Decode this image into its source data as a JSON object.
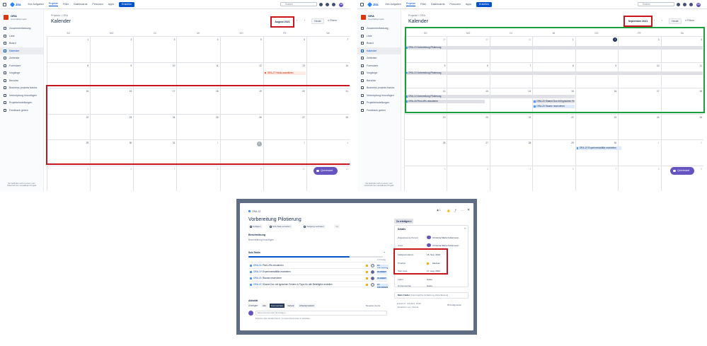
{
  "colors": {
    "brand": "#0052cc",
    "highlight_red": "#c9151e",
    "highlight_green": "#1b9e3e",
    "fab": "#6554c0",
    "project_icon": "#de350b"
  },
  "topbar": {
    "product": "Jira",
    "nav": [
      "Ihre Aufgaben",
      "Projekte",
      "Filter",
      "Dashboards",
      "Personen",
      "Apps"
    ],
    "create_label": "Erstellen",
    "search_placeholder": "Suchen",
    "avatar_initials": "CM",
    "icons": [
      "bell-icon",
      "help-icon",
      "settings-icon"
    ]
  },
  "sidebar": {
    "project_name": "ORA",
    "project_type": "Geschäftsprojekt",
    "items": [
      {
        "label": "Zusammenfassung",
        "icon": "summary-icon",
        "active": false
      },
      {
        "label": "Liste",
        "icon": "list-icon",
        "active": false
      },
      {
        "label": "Board",
        "icon": "board-icon",
        "active": false
      },
      {
        "label": "Kalender",
        "icon": "calendar-icon",
        "active": true
      },
      {
        "label": "Zeitleiste",
        "icon": "timeline-icon",
        "active": false
      },
      {
        "label": "Formulare",
        "icon": "forms-icon",
        "active": false
      },
      {
        "label": "Vorgänge",
        "icon": "issues-icon",
        "active": false
      },
      {
        "label": "Berichte",
        "icon": "reports-icon",
        "active": false
      },
      {
        "label": "Business projects basics",
        "icon": "book-icon",
        "active": false
      },
      {
        "label": "Verknüpfung hinzufügen",
        "icon": "link-icon",
        "active": false
      },
      {
        "label": "Projekteinstellungen",
        "icon": "gear-icon",
        "active": false
      },
      {
        "label": "Feedback geben",
        "icon": "megaphone-icon",
        "active": false
      }
    ],
    "footer": "Sie befinden sich in einem vom Unternehmen verwalteten Projekt"
  },
  "calendar_common": {
    "breadcrumb_root": "Projekte",
    "breadcrumb_project": "ORA",
    "title": "Kalender",
    "prev": "‹",
    "next": "›",
    "today_label": "Heute",
    "filter_label": "Filtern",
    "weekdays": [
      "SO",
      "MO",
      "DI",
      "MI",
      "DO",
      "FR",
      "SA"
    ],
    "fab_label": "Quickstart"
  },
  "left_calendar": {
    "month_label": "August 2021",
    "weeks": [
      [
        "1",
        "2",
        "3",
        "4",
        "5",
        "6",
        "7"
      ],
      [
        "8",
        "9",
        "10",
        "11",
        "12",
        "13",
        "14"
      ],
      [
        "15",
        "16",
        "17",
        "18",
        "19",
        "20",
        "21"
      ],
      [
        "22",
        "23",
        "24",
        "25",
        "26",
        "27",
        "28"
      ],
      [
        "29",
        "30",
        "31",
        "1",
        "2",
        "3",
        "4"
      ],
      [
        "5",
        "6",
        "7",
        "8",
        "9",
        "10",
        "11"
      ]
    ],
    "event": "ORA-27 Hosts auswählen"
  },
  "right_calendar": {
    "month_label": "September 2021",
    "weeks": [
      [
        "29",
        "30",
        "31",
        "1",
        "2",
        "3",
        "4"
      ],
      [
        "5",
        "6",
        "7",
        "8",
        "9",
        "10",
        "11"
      ],
      [
        "12",
        "13",
        "14",
        "15",
        "16",
        "17",
        "18"
      ],
      [
        "19",
        "20",
        "21",
        "22",
        "23",
        "24",
        "25"
      ],
      [
        "26",
        "27",
        "28",
        "29",
        "30",
        "1",
        "2"
      ],
      [
        "3",
        "4",
        "5",
        "6",
        "7",
        "8",
        "9"
      ]
    ],
    "events": [
      "ORA-13 Vorbereitung Pilotierung",
      "ORA-13 Vorbereitung Pilotierung",
      "ORA-13 Vorbereitung Pilotierung",
      "ORA-16 Pilot-URs rekrutieren",
      "ORA-22 Shared Doc mit typischen Fe...",
      "ORA-20 Räume reservieren",
      "ORA-19 Experimentalfälle erarbeiten"
    ]
  },
  "issue": {
    "breadcrumb": "ORA-13",
    "title": "Vorbereitung Pilotierung",
    "buttons": [
      "Anfügen",
      "Sub-Task erstellen",
      "Vorgang verlinken"
    ],
    "more": "•••",
    "description_label": "Beschreibung",
    "description_placeholder": "Beschreibung hinzufügen ...",
    "subtasks_label": "Sub-Tasks",
    "progress": 0.75,
    "progress_text": "3 % fertig",
    "subtasks": [
      {
        "key": "ORA-16",
        "summary": "Pilot-URs rekrutieren",
        "status": "ZU ERLEDIGEN"
      },
      {
        "key": "ORA-19",
        "summary": "Experimentalfälle erarbeiten",
        "status": "IN ARBEIT"
      },
      {
        "key": "ORA-20",
        "summary": "Räume reservieren",
        "status": "IN ARBEIT"
      },
      {
        "key": "ORA-22",
        "summary": "Shared Doc mit typischen Fehlern & Tipps für alle Beteiligten erstellen",
        "status": "ZU ERLEDIGEN"
      }
    ],
    "activity_label": "Aktivität",
    "show_label": "Anzeigen:",
    "activity_tabs": [
      "Alle",
      "Kommentare",
      "Verlauf",
      "Arbeitsprotokoll"
    ],
    "sort_label": "Neueste zuerst",
    "comment_placeholder": "Einen Kommentar hinzufügen ...",
    "comment_tip": "Experten-Tipp: Drücken Sie M , um einen Kommentar zu schreiben",
    "status_button": "Zu erledigen",
    "details_label": "Details",
    "assignee_label": "Zugewiesene Person",
    "assignee": "Christina Maria Kellermann",
    "reporter_label": "Autor",
    "reporter": "Christina Maria Kellermann",
    "due_label": "Fälligkeitsdatum",
    "due": "15. Sep. 2021",
    "priority_label": "Priorität",
    "priority": "Medium",
    "start_label": "Start date",
    "start": "17. Aug. 2021",
    "labels_label": "Label",
    "labels": "Keine",
    "components_label": "Komponenten",
    "components": "Keine",
    "more_fields_label": "Mehr Felder",
    "more_fields_hint": "Ursprüngliche Schätzung, Zeiterfassung",
    "created": "Erstellt 27. Juli 2021, 18:00",
    "updated": "Aktualisiert vor 1 Stunde",
    "configure": "Konfigurieren",
    "watch_count": "1"
  }
}
